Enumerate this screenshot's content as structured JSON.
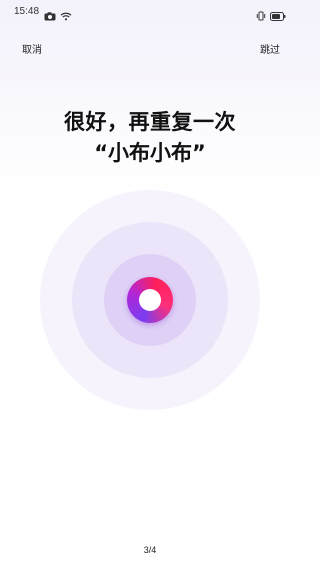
{
  "status_bar": {
    "time": "15:48",
    "icons": [
      "camera-icon",
      "wifi-icon",
      "vibrate-icon",
      "battery-icon"
    ]
  },
  "nav": {
    "cancel_label": "取消",
    "skip_label": "跳过"
  },
  "main": {
    "title_line1": "很好，再重复一次",
    "title_line2": "“小布小布”"
  },
  "footer": {
    "page_indicator": "3/4"
  },
  "colors": {
    "orb_gradient": [
      "#7a3df0",
      "#b026d8",
      "#ff1f5a",
      "#ff2f7a"
    ],
    "ring_purple": "#e6dcf8"
  }
}
